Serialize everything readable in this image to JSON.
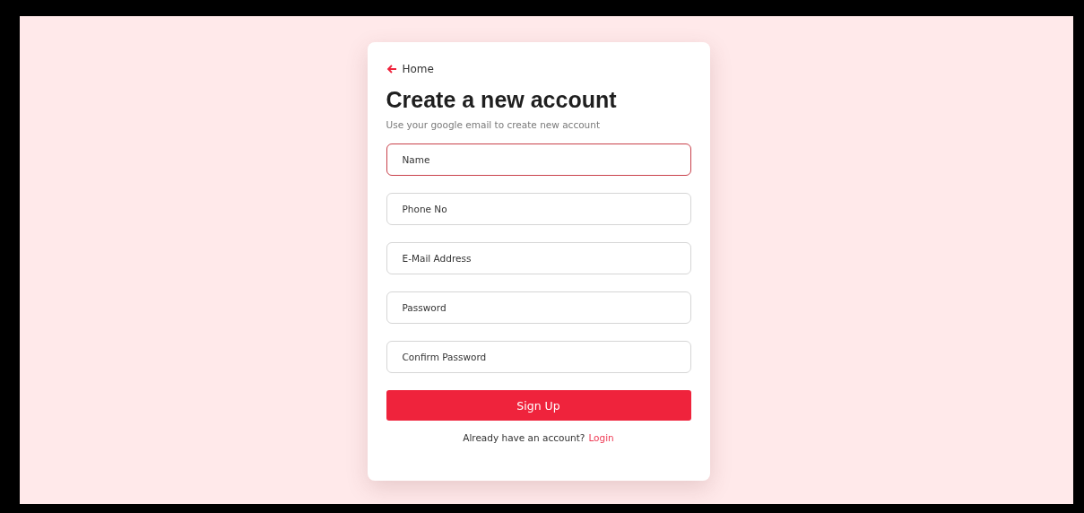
{
  "back_link": {
    "label": "Home"
  },
  "title": "Create a new account",
  "subtitle": "Use your google email to create new account",
  "fields": [
    {
      "placeholder": "Name",
      "focused": true
    },
    {
      "placeholder": "Phone No",
      "focused": false
    },
    {
      "placeholder": "E-Mail Address",
      "focused": false
    },
    {
      "placeholder": "Password",
      "focused": false
    },
    {
      "placeholder": "Confirm Password",
      "focused": false
    }
  ],
  "submit_button": "Sign Up",
  "footer": {
    "text": "Already have an account?",
    "link": "Login"
  }
}
